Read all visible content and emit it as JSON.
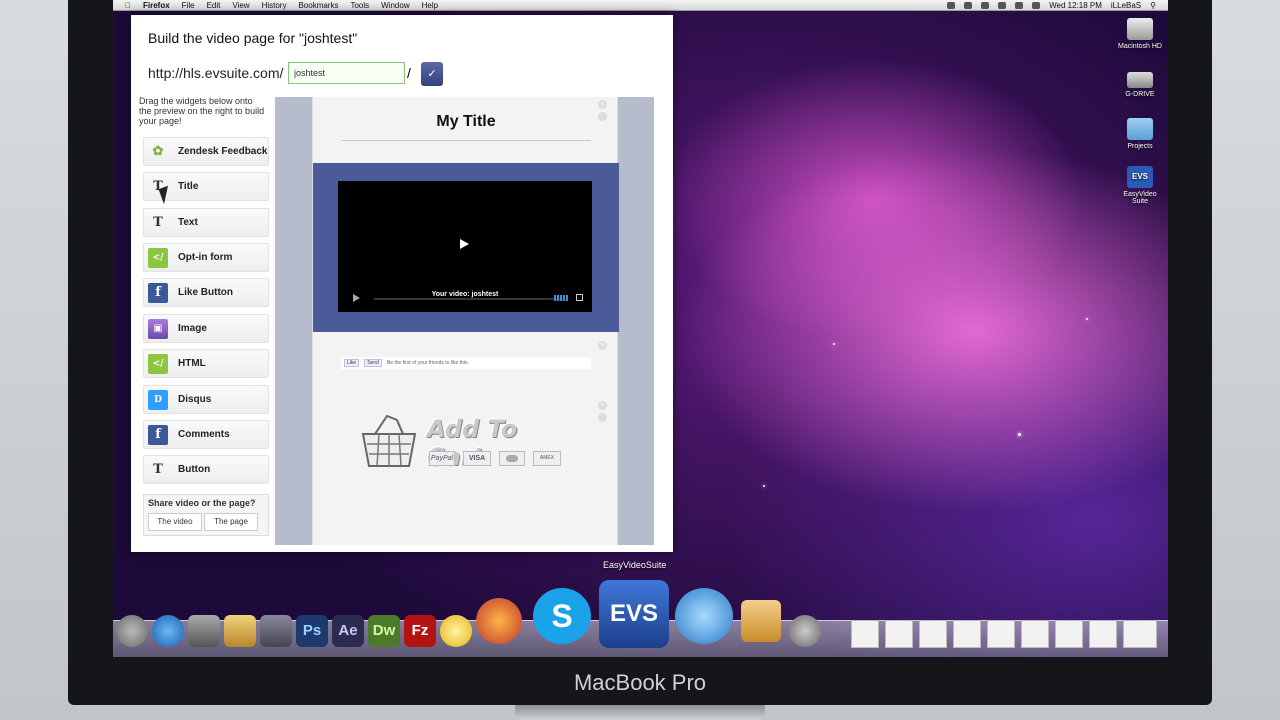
{
  "menubar": {
    "app": "Firefox",
    "items": [
      "File",
      "Edit",
      "View",
      "History",
      "Bookmarks",
      "Tools",
      "Window",
      "Help"
    ],
    "clock": "Wed 12:18 PM",
    "user": "iLLeBaS"
  },
  "desktop": {
    "icons": [
      {
        "label": "Macintosh HD",
        "icon": "hard-drive-icon"
      },
      {
        "label": "G-DRIVE",
        "icon": "external-drive-icon"
      },
      {
        "label": "Projects",
        "icon": "folder-icon"
      },
      {
        "label": "EasyVideo Suite",
        "icon": "evs-app-icon",
        "badge": "EVS"
      }
    ]
  },
  "panel": {
    "title": "Build the video page for \"joshtest\"",
    "url_prefix": "http://hls.evsuite.com/",
    "slug_value": "joshtest",
    "slash": "/",
    "confirm_glyph": "✓",
    "instructions": "Drag the widgets below onto the preview on the right to build your page!",
    "widgets": [
      {
        "label": "Zendesk Feedback",
        "icon": "zendesk-icon",
        "glyph": "✿",
        "color": "#7db742"
      },
      {
        "label": "Title",
        "icon": "text-t-icon",
        "glyph": "T",
        "color": "#ffffff"
      },
      {
        "label": "Text",
        "icon": "text-t-icon",
        "glyph": "T",
        "color": "#ffffff"
      },
      {
        "label": "Opt-in form",
        "icon": "code-icon",
        "glyph": "</",
        "color": "#8cc63f"
      },
      {
        "label": "Like Button",
        "icon": "facebook-icon",
        "glyph": "f",
        "color": "#3b5998"
      },
      {
        "label": "Image",
        "icon": "image-icon",
        "glyph": "▣",
        "color": "#8a5fb8"
      },
      {
        "label": "HTML",
        "icon": "code-icon",
        "glyph": "</",
        "color": "#8cc63f"
      },
      {
        "label": "Disqus",
        "icon": "disqus-icon",
        "glyph": "D",
        "color": "#2e9fff"
      },
      {
        "label": "Comments",
        "icon": "facebook-icon",
        "glyph": "f",
        "color": "#3b5998"
      },
      {
        "label": "Button",
        "icon": "text-t-icon",
        "glyph": "T",
        "color": "#ffffff"
      }
    ],
    "share": {
      "label": "Share video or the page?",
      "option_video": "The video",
      "option_page": "The page"
    }
  },
  "preview": {
    "title": "My Title",
    "video_caption": "Your video: joshtest",
    "facebook": {
      "like": "Like",
      "send": "Send",
      "text": "Be the first of your friends to like this."
    },
    "cart": {
      "text": "Add To Cart",
      "payments": [
        "PayPal",
        "VISA",
        "",
        "AMEX"
      ]
    },
    "close_glyph": "×"
  },
  "dock": {
    "tooltip": "EasyVideoSuite",
    "apps": [
      {
        "label": "",
        "icon": "rocket-icon",
        "color": "#777"
      },
      {
        "label": "",
        "icon": "app-store-icon",
        "color": "#2a7fd4"
      },
      {
        "label": "",
        "icon": "system-prefs-icon",
        "color": "#888"
      },
      {
        "label": "",
        "icon": "cocktail-icon",
        "color": "#caa24a"
      },
      {
        "label": "",
        "icon": "photo-browser-icon",
        "color": "#667"
      },
      {
        "label": "Ps",
        "icon": "photoshop-icon",
        "color": "#1c3a6e"
      },
      {
        "label": "Ae",
        "icon": "after-effects-icon",
        "color": "#2b2b52"
      },
      {
        "label": "Dw",
        "icon": "dreamweaver-icon",
        "color": "#4b7a2b"
      },
      {
        "label": "Fz",
        "icon": "filezilla-icon",
        "color": "#b31313"
      },
      {
        "label": "",
        "icon": "flower-icon",
        "color": "#e8b41a"
      },
      {
        "label": "",
        "icon": "firefox-icon",
        "color": "#e26a1e"
      },
      {
        "label": "S",
        "icon": "skype-icon",
        "color": "#1aa3e8"
      },
      {
        "label": "EVS",
        "icon": "evs-app-icon",
        "color": "#2a5bb6"
      },
      {
        "label": "",
        "icon": "mail-bird-icon",
        "color": "#3a8fd9"
      },
      {
        "label": "",
        "icon": "keynote-icon",
        "color": "#c98a2a"
      },
      {
        "label": "",
        "icon": "gimp-icon",
        "color": "#777"
      }
    ]
  },
  "device_label": "MacBook Pro"
}
